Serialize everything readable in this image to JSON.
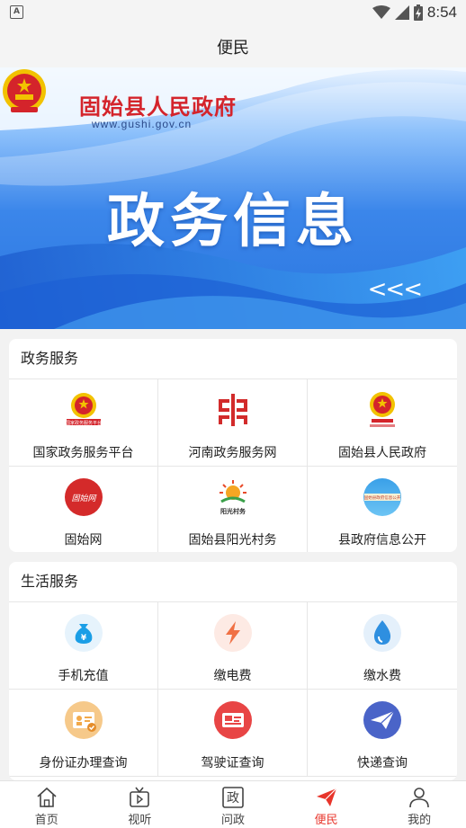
{
  "status_bar": {
    "time": "8:54",
    "app_icon_letter": "A"
  },
  "nav": {
    "title": "便民"
  },
  "banner": {
    "org_name": "固始县人民政府",
    "url": "www.gushi.gov.cn",
    "headline": "政务信息",
    "arrows": "<<<"
  },
  "gov_services": {
    "title": "政务服务",
    "items": [
      {
        "label": "国家政务服务平台",
        "icon": "national-emblem-icon"
      },
      {
        "label": "河南政务服务网",
        "icon": "henan-gov-logo-icon"
      },
      {
        "label": "固始县人民政府",
        "icon": "national-emblem-icon"
      },
      {
        "label": "固始网",
        "icon": "gushi-net-logo-icon"
      },
      {
        "label": "固始县阳光村务",
        "icon": "sunshine-village-logo-icon"
      },
      {
        "label": "县政府信息公开",
        "icon": "gov-info-logo-icon"
      }
    ],
    "logo_captions": {
      "national_platform": "国家政务服务平台",
      "sunshine": "阳光村务",
      "gushi_net": "固始网",
      "gov_info": "固始县政府信息公开"
    }
  },
  "life_services": {
    "title": "生活服务",
    "items": [
      {
        "label": "手机充值",
        "icon": "money-bag-icon",
        "symbol": "¥"
      },
      {
        "label": "缴电费",
        "icon": "lightning-icon"
      },
      {
        "label": "缴水费",
        "icon": "water-drop-icon"
      },
      {
        "label": "身份证办理查询",
        "icon": "id-card-icon"
      },
      {
        "label": "驾驶证查询",
        "icon": "driver-license-icon"
      },
      {
        "label": "快递查询",
        "icon": "paper-plane-icon"
      }
    ]
  },
  "tabbar": {
    "active": "便民",
    "items": [
      {
        "label": "首页",
        "icon": "home-icon"
      },
      {
        "label": "视听",
        "icon": "tv-icon"
      },
      {
        "label": "问政",
        "icon": "gov-question-icon",
        "glyph": "政"
      },
      {
        "label": "便民",
        "icon": "send-icon"
      },
      {
        "label": "我的",
        "icon": "user-icon"
      }
    ]
  },
  "colors": {
    "accent_red": "#e8352b",
    "banner_blue": "#2f7fe6",
    "emblem_red": "#d4242b",
    "emblem_gold": "#f2c200"
  }
}
